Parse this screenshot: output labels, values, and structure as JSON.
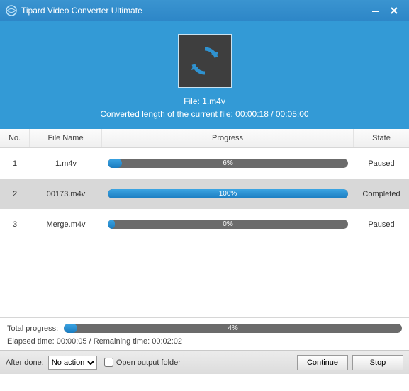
{
  "window": {
    "title": "Tipard Video Converter Ultimate"
  },
  "hero": {
    "file_label": "File: 1.m4v",
    "converted_line": "Converted length of the current file: 00:00:18 / 00:05:00"
  },
  "table": {
    "headers": {
      "no": "No.",
      "filename": "File Name",
      "progress": "Progress",
      "state": "State"
    },
    "rows": [
      {
        "no": "1",
        "name": "1.m4v",
        "pct": 6,
        "pct_label": "6%",
        "state": "Paused"
      },
      {
        "no": "2",
        "name": "00173.m4v",
        "pct": 100,
        "pct_label": "100%",
        "state": "Completed"
      },
      {
        "no": "3",
        "name": "Merge.m4v",
        "pct": 0,
        "pct_label": "0%",
        "state": "Paused"
      }
    ]
  },
  "totals": {
    "label": "Total progress:",
    "pct": 4,
    "pct_label": "4%",
    "elapsed_line": "Elapsed time: 00:00:05 / Remaining time: 00:02:02"
  },
  "footer": {
    "after_done_label": "After done:",
    "after_done_value": "No action",
    "open_output_label": "Open output folder",
    "continue_label": "Continue",
    "stop_label": "Stop"
  }
}
